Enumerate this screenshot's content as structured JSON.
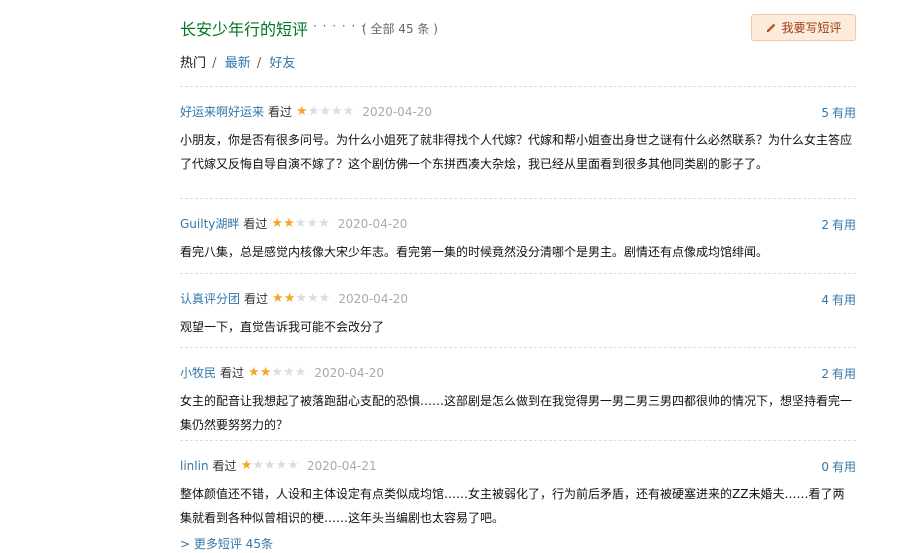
{
  "header": {
    "title": "长安少年行的短评",
    "dots": "· · · · · ·",
    "count_text": "( 全部 45 条 )",
    "write_button": "我要写短评",
    "write_icon": "pencil-icon"
  },
  "tabs": {
    "hot": "热门",
    "sep1": "/",
    "latest": "最新",
    "sep2": "/",
    "friends": "好友"
  },
  "comments": [
    {
      "author": "好运来啊好运来",
      "status": "看过",
      "rating": 1,
      "date": "2020-04-20",
      "votes": "5",
      "votes_label": "有用",
      "text": "小朋友，你是否有很多问号。为什么小姐死了就非得找个人代嫁？代嫁和帮小姐查出身世之谜有什么必然联系？为什么女主答应了代嫁又反悔自导自演不嫁了？这个剧仿佛一个东拼西凑大杂烩，我已经从里面看到很多其他同类剧的影子了。"
    },
    {
      "author": "Guilty湖畔",
      "status": "看过",
      "rating": 2,
      "date": "2020-04-20",
      "votes": "2",
      "votes_label": "有用",
      "text": "看完八集，总是感觉内核像大宋少年志。看完第一集的时候竟然没分清哪个是男主。剧情还有点像成均馆绯闻。"
    },
    {
      "author": "认真评分团",
      "status": "看过",
      "rating": 2,
      "date": "2020-04-20",
      "votes": "4",
      "votes_label": "有用",
      "text": "观望一下，直觉告诉我可能不会改分了"
    },
    {
      "author": "小牧民",
      "status": "看过",
      "rating": 2,
      "date": "2020-04-20",
      "votes": "2",
      "votes_label": "有用",
      "text": "女主的配音让我想起了被落跑甜心支配的恐惧……这部剧是怎么做到在我觉得男一男二男三男四都很帅的情况下，想坚持看完一集仍然要努努力的？"
    },
    {
      "author": "linlin",
      "status": "看过",
      "rating": 1,
      "date": "2020-04-21",
      "votes": "0",
      "votes_label": "有用",
      "text": "整体颜值还不错，人设和主体设定有点类似成均馆……女主被弱化了，行为前后矛盾，还有被硬塞进来的ZZ未婚夫……看了两集就看到各种似曾相识的梗……这年头当编剧也太容易了吧。"
    }
  ],
  "more_link": "> 更多短评 45条"
}
